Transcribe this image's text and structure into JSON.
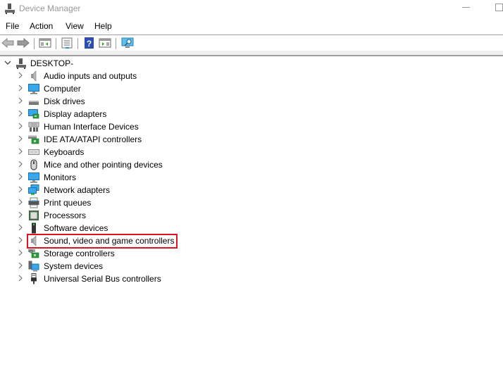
{
  "window": {
    "title": "Device Manager",
    "minimize_icon": "minimize-icon",
    "maximize_icon": "maximize-icon"
  },
  "menu": [
    "File",
    "Action",
    "View",
    "Help"
  ],
  "toolbar": {
    "buttons": [
      {
        "name": "back-button",
        "icon": "arrow-left-icon"
      },
      {
        "name": "forward-button",
        "icon": "arrow-right-icon"
      },
      {
        "name": "show-hide-console-tree-button",
        "icon": "console-tree-icon"
      },
      {
        "name": "properties-button",
        "icon": "properties-icon"
      },
      {
        "name": "help-button",
        "icon": "help-icon"
      },
      {
        "name": "show-action-pane-button",
        "icon": "action-pane-icon"
      },
      {
        "name": "scan-hardware-button",
        "icon": "scan-monitor-icon"
      }
    ]
  },
  "tree": {
    "root": {
      "label": "DESKTOP-",
      "icon": "computer-tower-icon",
      "expanded": true
    },
    "items": [
      {
        "label": "Audio inputs and outputs",
        "icon": "speaker-icon"
      },
      {
        "label": "Computer",
        "icon": "monitor-icon"
      },
      {
        "label": "Disk drives",
        "icon": "disk-drive-icon"
      },
      {
        "label": "Display adapters",
        "icon": "display-adapter-icon"
      },
      {
        "label": "Human Interface Devices",
        "icon": "hid-icon"
      },
      {
        "label": "IDE ATA/ATAPI controllers",
        "icon": "ide-controller-icon"
      },
      {
        "label": "Keyboards",
        "icon": "keyboard-icon"
      },
      {
        "label": "Mice and other pointing devices",
        "icon": "mouse-icon"
      },
      {
        "label": "Monitors",
        "icon": "monitor-icon"
      },
      {
        "label": "Network adapters",
        "icon": "network-adapter-icon"
      },
      {
        "label": "Print queues",
        "icon": "printer-icon"
      },
      {
        "label": "Processors",
        "icon": "processor-icon"
      },
      {
        "label": "Software devices",
        "icon": "software-device-icon"
      },
      {
        "label": "Sound, video and game controllers",
        "icon": "speaker-icon",
        "highlighted": true
      },
      {
        "label": "Storage controllers",
        "icon": "storage-controller-icon"
      },
      {
        "label": "System devices",
        "icon": "system-devices-icon"
      },
      {
        "label": "Universal Serial Bus controllers",
        "icon": "usb-icon"
      }
    ]
  },
  "colors": {
    "highlight_border": "#e0141e",
    "separator": "#a0a0a0",
    "title_text": "#999999"
  }
}
